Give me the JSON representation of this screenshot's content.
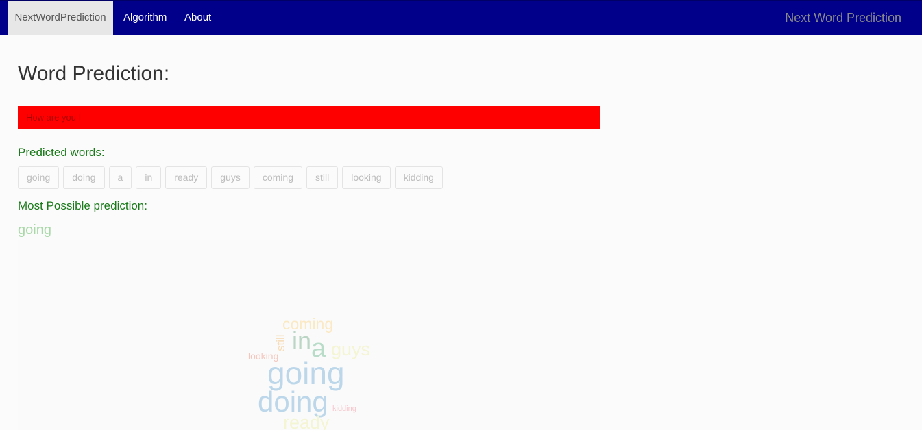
{
  "navbar": {
    "brand": "NextWordPrediction",
    "links": [
      "Algorithm",
      "About"
    ],
    "right_title": "Next Word Prediction"
  },
  "main": {
    "title": "Word Prediction:",
    "input": {
      "value": "How are you I"
    },
    "predicted_label": "Predicted words:",
    "predicted_words": [
      "going",
      "doing",
      "a",
      "in",
      "ready",
      "guys",
      "coming",
      "still",
      "looking",
      "kidding"
    ],
    "most_possible_label": "Most Possible prediction:",
    "most_possible_word": "going"
  },
  "word_cloud": {
    "words": [
      {
        "text": "coming",
        "color": "#fbe9c4"
      },
      {
        "text": "still",
        "color": "#f6dcb8"
      },
      {
        "text": "in",
        "color": "#bcd6c6"
      },
      {
        "text": "a",
        "color": "#b9dcc9"
      },
      {
        "text": "guys",
        "color": "#f4f5d2"
      },
      {
        "text": "looking",
        "color": "#f4c7bd"
      },
      {
        "text": "going",
        "color": "#bcd7ea"
      },
      {
        "text": "doing",
        "color": "#bcd7ea"
      },
      {
        "text": "kidding",
        "color": "#f7c8cf"
      },
      {
        "text": "ready",
        "color": "#f4f5d2"
      }
    ]
  }
}
